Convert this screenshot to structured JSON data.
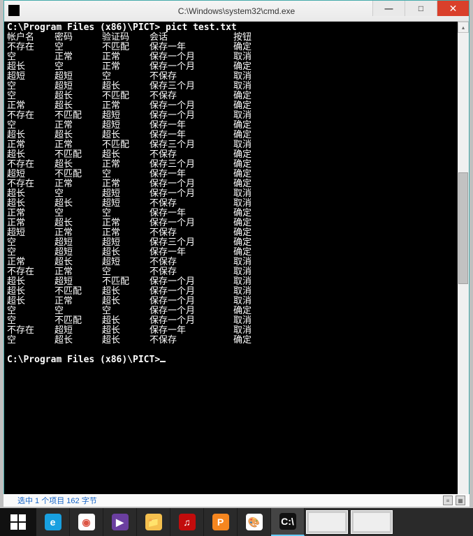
{
  "window": {
    "title": "C:\\Windows\\system32\\cmd.exe",
    "min_label": "—",
    "max_label": "□",
    "close_label": "✕"
  },
  "console": {
    "prompt1": "C:\\Program Files (x86)\\PICT> pict test.txt",
    "prompt2": "C:\\Program Files (x86)\\PICT>",
    "headers": [
      "帐户名",
      "密码",
      "验证码",
      "会话",
      "按钮"
    ],
    "rows": [
      [
        "不存在",
        "空",
        "不匹配",
        "保存一年",
        "确定"
      ],
      [
        "空",
        "正常",
        "正常",
        "保存一个月",
        "取消"
      ],
      [
        "超长",
        "空",
        "正常",
        "保存一个月",
        "确定"
      ],
      [
        "超短",
        "超短",
        "空",
        "不保存",
        "取消"
      ],
      [
        "空",
        "超短",
        "超长",
        "保存三个月",
        "取消"
      ],
      [
        "空",
        "超长",
        "不匹配",
        "不保存",
        "确定"
      ],
      [
        "正常",
        "超长",
        "正常",
        "保存一个月",
        "确定"
      ],
      [
        "不存在",
        "不匹配",
        "超短",
        "保存一个月",
        "取消"
      ],
      [
        "空",
        "正常",
        "超短",
        "保存一年",
        "确定"
      ],
      [
        "超长",
        "超长",
        "超长",
        "保存一年",
        "确定"
      ],
      [
        "正常",
        "正常",
        "不匹配",
        "保存三个月",
        "取消"
      ],
      [
        "超长",
        "不匹配",
        "超长",
        "不保存",
        "确定"
      ],
      [
        "不存在",
        "超长",
        "正常",
        "保存三个月",
        "确定"
      ],
      [
        "超短",
        "不匹配",
        "空",
        "保存一年",
        "确定"
      ],
      [
        "不存在",
        "正常",
        "正常",
        "保存一个月",
        "确定"
      ],
      [
        "超长",
        "空",
        "超短",
        "保存一个月",
        "取消"
      ],
      [
        "超长",
        "超长",
        "超短",
        "不保存",
        "取消"
      ],
      [
        "正常",
        "空",
        "空",
        "保存一年",
        "确定"
      ],
      [
        "正常",
        "超长",
        "正常",
        "保存一个月",
        "确定"
      ],
      [
        "超短",
        "正常",
        "正常",
        "不保存",
        "确定"
      ],
      [
        "空",
        "超短",
        "超短",
        "保存三个月",
        "确定"
      ],
      [
        "空",
        "超短",
        "超长",
        "保存一年",
        "确定"
      ],
      [
        "正常",
        "超长",
        "超短",
        "不保存",
        "取消"
      ],
      [
        "不存在",
        "正常",
        "空",
        "不保存",
        "取消"
      ],
      [
        "超长",
        "超短",
        "不匹配",
        "保存一个月",
        "取消"
      ],
      [
        "超长",
        "不匹配",
        "超长",
        "保存一个月",
        "取消"
      ],
      [
        "超长",
        "正常",
        "超长",
        "保存一个月",
        "取消"
      ],
      [
        "空",
        "空",
        "空",
        "保存一个月",
        "确定"
      ],
      [
        "空",
        "不匹配",
        "超长",
        "保存一个月",
        "取消"
      ],
      [
        "不存在",
        "超短",
        "超长",
        "保存一年",
        "取消"
      ],
      [
        "空",
        "超长",
        "超长",
        "不保存",
        "确定"
      ]
    ]
  },
  "statusbar": {
    "text": "选中 1 个项目 162 字节"
  },
  "taskbar": {
    "items": [
      {
        "name": "start",
        "label": ""
      },
      {
        "name": "ie",
        "label": "e",
        "bg": "#18a0e0",
        "fg": "#fff"
      },
      {
        "name": "chrome",
        "label": "◉",
        "bg": "#fff",
        "fg": "#d54"
      },
      {
        "name": "media",
        "label": "▶",
        "bg": "#6b3fa0",
        "fg": "#fff"
      },
      {
        "name": "explorer",
        "label": "📁",
        "bg": "#f5c04e",
        "fg": "#333"
      },
      {
        "name": "netease",
        "label": "♫",
        "bg": "#c20c0c",
        "fg": "#fff"
      },
      {
        "name": "wps",
        "label": "P",
        "bg": "#f5861f",
        "fg": "#fff"
      },
      {
        "name": "paint",
        "label": "🎨",
        "bg": "#fff",
        "fg": "#333"
      },
      {
        "name": "cmd",
        "label": "C:\\",
        "bg": "#111",
        "fg": "#fff",
        "active": true
      }
    ]
  }
}
